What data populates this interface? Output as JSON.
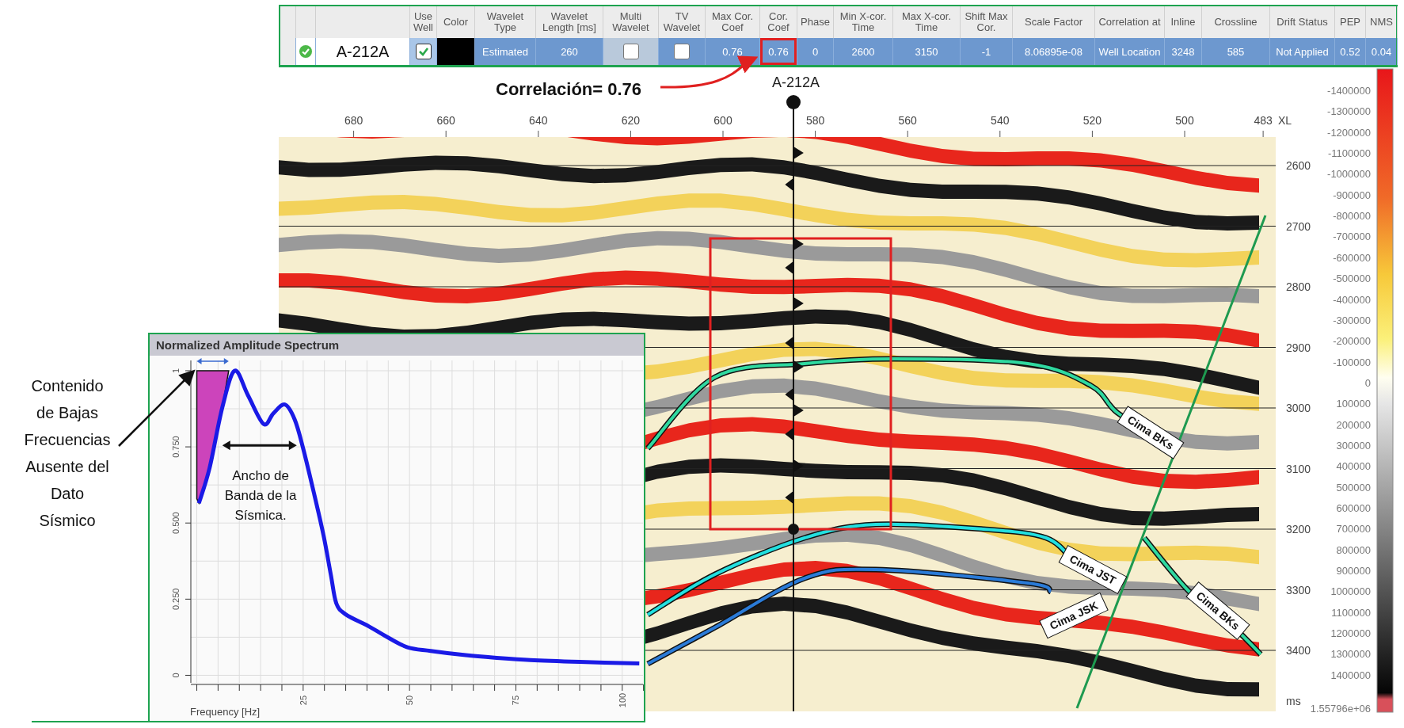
{
  "well_table": {
    "columns": [
      {
        "kind": "status"
      },
      {
        "kind": "name",
        "value": "A-212A"
      },
      {
        "header": "Use Well",
        "kind": "check",
        "checked": true
      },
      {
        "header": "Color",
        "kind": "swatch",
        "color": "#000000"
      },
      {
        "header": "Wavelet Type",
        "kind": "text",
        "value": "Estimated"
      },
      {
        "header": "Wavelet Length [ms]",
        "kind": "text",
        "value": "260"
      },
      {
        "header": "Multi Wavelet",
        "kind": "check",
        "checked": false
      },
      {
        "header": "TV Wavelet",
        "kind": "check",
        "checked": false
      },
      {
        "header": "Max Cor. Coef",
        "kind": "text",
        "value": "0.76"
      },
      {
        "header": "Cor. Coef",
        "kind": "text",
        "value": "0.76",
        "highlighted": true
      },
      {
        "header": "Phase",
        "kind": "text",
        "value": "0"
      },
      {
        "header": "Min X-cor. Time",
        "kind": "text",
        "value": "2600"
      },
      {
        "header": "Max X-cor. Time",
        "kind": "text",
        "value": "3150"
      },
      {
        "header": "Shift Max Cor.",
        "kind": "text",
        "value": "-1"
      },
      {
        "header": "Scale Factor",
        "kind": "text",
        "value": "8.06895e-08"
      },
      {
        "header": "Correlation at",
        "kind": "text",
        "value": "Well Location"
      },
      {
        "header": "Inline",
        "kind": "text",
        "value": "3248"
      },
      {
        "header": "Crossline",
        "kind": "text",
        "value": "585"
      },
      {
        "header": "Drift Status",
        "kind": "text",
        "value": "Not Applied"
      },
      {
        "header": "PEP",
        "kind": "text",
        "value": "0.52"
      },
      {
        "header": "NMS",
        "kind": "text",
        "value": "0.04"
      }
    ]
  },
  "correlation_note": "Correlación= 0.76",
  "seismic_section": {
    "well_label": "A-212A",
    "xl_axis_label": "XL",
    "time_unit": "ms",
    "xl_ticks": [
      "680",
      "660",
      "640",
      "620",
      "600",
      "580",
      "560",
      "540",
      "520",
      "500",
      "483"
    ],
    "time_ticks": [
      "2600",
      "2700",
      "2800",
      "2900",
      "3000",
      "3100",
      "3200",
      "3300",
      "3400"
    ],
    "horizons": [
      {
        "label": "Cima BKs",
        "color": "#2fd9a0"
      },
      {
        "label": "Cima JST",
        "color": "#22e0e0"
      },
      {
        "label": "Cima JSK",
        "color": "#2a7bd8"
      },
      {
        "label": "Cima BKs",
        "color": "#2fd9a0"
      }
    ],
    "colorbar_labels": [
      "-1400000",
      "-1300000",
      "-1200000",
      "-1100000",
      "-1000000",
      "-900000",
      "-800000",
      "-700000",
      "-600000",
      "-500000",
      "-400000",
      "-300000",
      "-200000",
      "-100000",
      "0",
      "100000",
      "200000",
      "300000",
      "400000",
      "500000",
      "600000",
      "700000",
      "800000",
      "900000",
      "1000000",
      "1100000",
      "1200000",
      "1300000",
      "1400000",
      "1.55796e+06"
    ]
  },
  "spectrum_panel": {
    "title": "Normalized Amplitude Spectrum",
    "chart_data": {
      "type": "line",
      "xlabel": "Frequency [Hz]",
      "xlim": [
        -1.4,
        104.6
      ],
      "ylim": [
        -0.03,
        1.04
      ],
      "xticks": [
        25,
        50,
        75,
        100
      ],
      "yticks": [
        {
          "value": 0,
          "label": "0"
        },
        {
          "value": 0.25,
          "label": "0.250"
        },
        {
          "value": 0.5,
          "label": "0.500"
        },
        {
          "value": 0.75,
          "label": "0.750"
        },
        {
          "value": 1,
          "label": "1"
        }
      ],
      "x": [
        0.5,
        3,
        6,
        8.9,
        12,
        15.7,
        18,
        20.7,
        23,
        25,
        27.5,
        29.8,
        31.5,
        32.8,
        35,
        40.4,
        44.2,
        49.5,
        55,
        63.2,
        70,
        78.4,
        90,
        104
      ],
      "grid": true,
      "series": [
        {
          "color": "#1a1ae6",
          "values": [
            0.565,
            0.68,
            0.88,
            1.0,
            0.92,
            0.825,
            0.86,
            0.889,
            0.84,
            0.745,
            0.6,
            0.459,
            0.33,
            0.236,
            0.2,
            0.161,
            0.13,
            0.092,
            0.08,
            0.066,
            0.058,
            0.05,
            0.044,
            0.039
          ]
        }
      ],
      "annotations": [
        "Ancho de\nBanda de la\nSísmica."
      ]
    }
  },
  "low_frequency_note": "Contenido\nde Bajas\nFrecuencias\nAusente del\nDato\nSísmico"
}
